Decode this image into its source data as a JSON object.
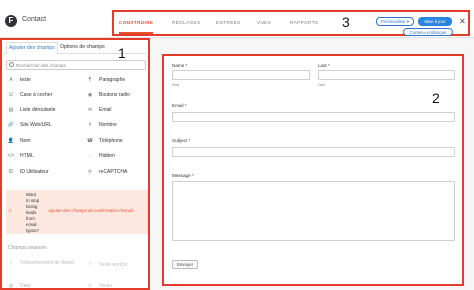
{
  "header": {
    "logo_glyph": "F",
    "form_title": "Contact",
    "tabs": [
      {
        "label": "CONSTRUIRE",
        "active": true
      },
      {
        "label": "RÉGLAGES",
        "active": false
      },
      {
        "label": "ENTRÉES",
        "active": false
      },
      {
        "label": "VUES",
        "active": false
      },
      {
        "label": "RAPPORTS",
        "active": false
      }
    ],
    "box_number": "3",
    "preview_label": "Prévisualiser ▾",
    "update_label": "Mise à jour",
    "embed_label": "Contenu embarqué",
    "close_glyph": "✕"
  },
  "sidebar": {
    "box_number": "1",
    "tabs": [
      "Ajouter des champs",
      "Options de champs"
    ],
    "search_placeholder": "Rechercher des champs",
    "fields": [
      {
        "label": "texte",
        "icon": "A"
      },
      {
        "label": "Paragraphe",
        "icon": "¶"
      },
      {
        "label": "Case à cocher",
        "icon": "☑"
      },
      {
        "label": "Boutons radio",
        "icon": "◉"
      },
      {
        "label": "Liste déroulante",
        "icon": "▤"
      },
      {
        "label": "Email",
        "icon": "✉"
      },
      {
        "label": "Site Web/URL",
        "icon": "🔗"
      },
      {
        "label": "Nombre",
        "icon": "#"
      },
      {
        "label": "Nom",
        "icon": "👤"
      },
      {
        "label": "Téléphone",
        "icon": "☎"
      },
      {
        "label": "HTML",
        "icon": "</>"
      },
      {
        "label": "Hidden",
        "icon": "◌"
      },
      {
        "label": "ID Utilisateur",
        "icon": "ID"
      },
      {
        "label": "reCAPTCHA",
        "icon": "⟳"
      }
    ],
    "promo": {
      "text_lines": [
        "Want",
        "to stop",
        "losing",
        "leads",
        "from",
        "email",
        "typos?"
      ],
      "link": "Ajouter des champs de confirmation d'email."
    },
    "advanced_heading": "Champs avancés",
    "advanced_fields": [
      {
        "label": "Téléversement de fichier",
        "icon": "⇪"
      },
      {
        "label": "Texte enrichi",
        "icon": "T"
      },
      {
        "label": "Date",
        "icon": "▦"
      },
      {
        "label": "Heure",
        "icon": "◷"
      }
    ]
  },
  "canvas": {
    "box_number": "2",
    "name_label": "Name *",
    "first_sub": "First",
    "last_label": "Last *",
    "last_sub": "Last",
    "email_label": "Email *",
    "subject_label": "Subject *",
    "message_label": "Message *",
    "submit_label": "Envoyer"
  }
}
